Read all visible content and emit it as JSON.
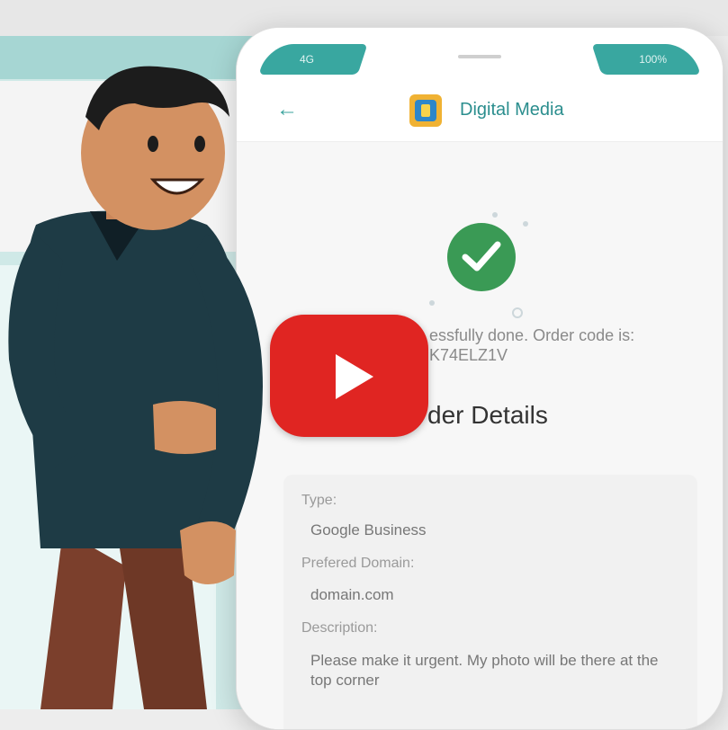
{
  "app": {
    "title": "Digital Media",
    "status_left": "4G",
    "status_right": "100%"
  },
  "order": {
    "success_message": "essfully done. Order code is:",
    "order_code": "K74ELZ1V",
    "details_title": "der Details"
  },
  "details": {
    "type_label": "Type:",
    "type_value": "Google Business",
    "domain_label": "Prefered Domain:",
    "domain_value": "domain.com",
    "description_label": "Description:",
    "description_value": "Please make it urgent. My photo will be there at the top corner"
  },
  "colors": {
    "accent": "#39a7a0",
    "success": "#3a9a55",
    "youtube": "#e02522"
  },
  "icons": {
    "back": "arrow-left-icon",
    "success": "check-circle-icon",
    "play": "youtube-play-icon"
  }
}
